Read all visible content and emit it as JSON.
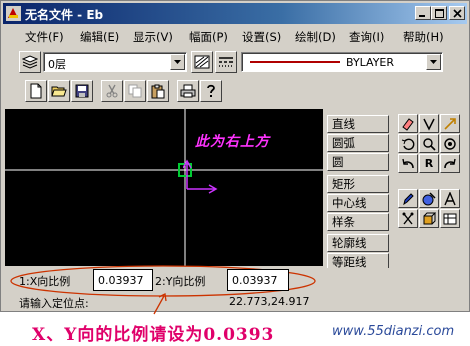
{
  "window": {
    "title": "无名文件 - Eb",
    "controls": {
      "minimize": "_",
      "maximize": "□",
      "close": "×"
    }
  },
  "menubar": {
    "items": [
      {
        "label": "文件(F)"
      },
      {
        "label": "编辑(E)"
      },
      {
        "label": "显示(V)"
      },
      {
        "label": "幅面(P)"
      },
      {
        "label": "设置(S)"
      },
      {
        "label": "绘制(D)"
      },
      {
        "label": "查询(I)"
      },
      {
        "label": "帮助(H)"
      }
    ]
  },
  "toolbar": {
    "layer_value": "0层",
    "linetype_value": "BYLAYER"
  },
  "canvas": {
    "annotation_text": "此为右上方",
    "annotation_color": "#ff33ff",
    "crosshair_color": "#ffffff",
    "cursor_color": "#00cc33",
    "arrow_color": "#cc33ff"
  },
  "commands": {
    "items": [
      {
        "label": "直线"
      },
      {
        "label": "圆弧"
      },
      {
        "label": "圆"
      },
      {
        "label": "矩形"
      },
      {
        "label": "中心线"
      },
      {
        "label": "样条"
      },
      {
        "label": "轮廓线"
      },
      {
        "label": "等距线"
      }
    ]
  },
  "iconpanel": {
    "r_label": "R"
  },
  "inputs": {
    "x_label": "1:X向比例",
    "x_value": "0.03937",
    "y_label": "2:Y向比例",
    "y_value": "0.03937"
  },
  "status": {
    "prompt": "请输入定位点:",
    "coords": "22.773,24.917"
  },
  "annotation": {
    "caption": "X、Y向的比例请设为0.0393",
    "website": "www.55dianzi.com",
    "highlight_color": "#cc3300"
  }
}
